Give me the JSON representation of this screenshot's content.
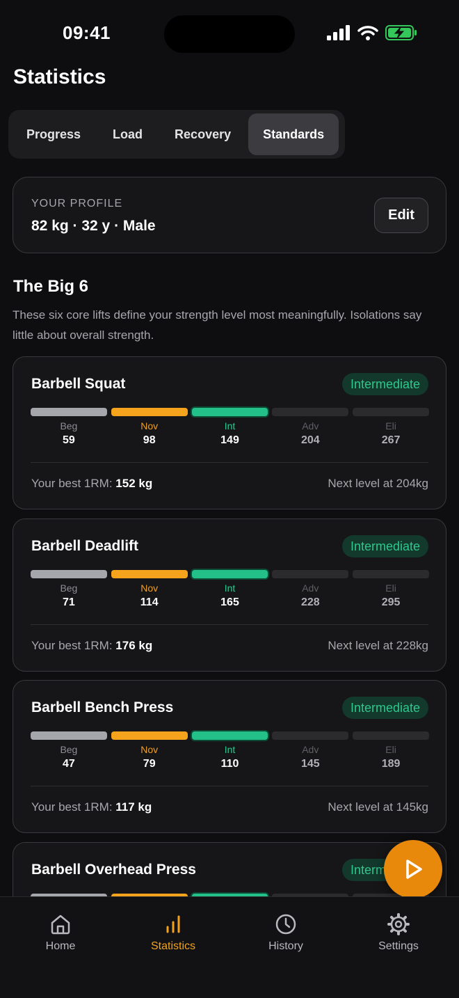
{
  "status": {
    "time": "09:41"
  },
  "page": {
    "title": "Statistics"
  },
  "segments": [
    {
      "label": "Progress",
      "active": false
    },
    {
      "label": "Load",
      "active": false
    },
    {
      "label": "Recovery",
      "active": false
    },
    {
      "label": "Standards",
      "active": true
    }
  ],
  "profile": {
    "label": "YOUR PROFILE",
    "value": "82 kg · 32 y · Male",
    "edit_label": "Edit"
  },
  "section": {
    "title": "The Big 6",
    "description": "These six core lifts define your strength level most meaningfully. Isolations say little about overall strength."
  },
  "level_labels": [
    "Beg",
    "Nov",
    "Int",
    "Adv",
    "Eli"
  ],
  "lifts": [
    {
      "name": "Barbell Squat",
      "badge": "Intermediate",
      "values": [
        "59",
        "98",
        "149",
        "204",
        "267"
      ],
      "best_label": "Your best 1RM:",
      "best_value": "152 kg",
      "next": "Next level at 204kg"
    },
    {
      "name": "Barbell Deadlift",
      "badge": "Intermediate",
      "values": [
        "71",
        "114",
        "165",
        "228",
        "295"
      ],
      "best_label": "Your best 1RM:",
      "best_value": "176 kg",
      "next": "Next level at 228kg"
    },
    {
      "name": "Barbell Bench Press",
      "badge": "Intermediate",
      "values": [
        "47",
        "79",
        "110",
        "145",
        "189"
      ],
      "best_label": "Your best 1RM:",
      "best_value": "117 kg",
      "next": "Next level at 145kg"
    },
    {
      "name": "Barbell Overhead Press",
      "badge": "Intermediate"
    }
  ],
  "tabbar": [
    {
      "label": "Home",
      "icon": "home-icon"
    },
    {
      "label": "Statistics",
      "icon": "bar-chart-icon"
    },
    {
      "label": "History",
      "icon": "clock-icon"
    },
    {
      "label": "Settings",
      "icon": "gear-icon"
    }
  ],
  "colors": {
    "accent": "#f5a21c",
    "intermediate": "#24c089",
    "fab": "#e8890c"
  }
}
